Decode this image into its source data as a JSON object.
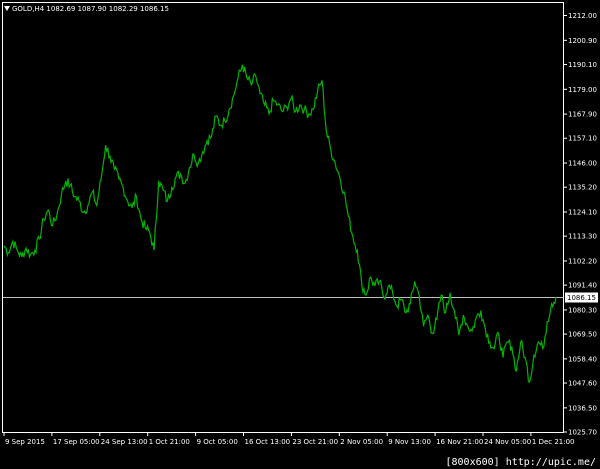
{
  "header": {
    "symbol": "GOLD,H4",
    "open": "1082.69",
    "high": "1087.90",
    "low": "1082.29",
    "close": "1086.15"
  },
  "current_price_label": "1086.15",
  "watermark": "[800x600] http://upic.me/",
  "colors": {
    "background": "#000000",
    "axis": "#ffffff",
    "series": "#00b400",
    "bid_line": "#c0c0c0",
    "text": "#ffffff"
  },
  "chart_data": {
    "type": "line",
    "title": "GOLD,H4",
    "y_ticks": [
      "1212.00",
      "1200.90",
      "1190.10",
      "1179.00",
      "1167.90",
      "1157.10",
      "1146.00",
      "1135.20",
      "1124.10",
      "1113.30",
      "1102.20",
      "1091.40",
      "1080.30",
      "1069.50",
      "1058.40",
      "1047.60",
      "1036.50",
      "1025.70"
    ],
    "x_ticks": [
      "9 Sep 2015",
      "17 Sep 05:00",
      "24 Sep 13:00",
      "1 Oct 21:00",
      "9 Oct 05:00",
      "16 Oct 13:00",
      "23 Oct 21:00",
      "2 Nov 05:00",
      "9 Nov 13:00",
      "16 Nov 21:00",
      "24 Nov 05:00",
      "1 Dec 21:00"
    ],
    "ylim": [
      1025.7,
      1212.0
    ],
    "bid": 1086.15,
    "series": [
      {
        "values": [
          1109,
          1106,
          1111,
          1107,
          1104,
          1108,
          1105,
          1107,
          1112,
          1121,
          1125,
          1118,
          1123,
          1132,
          1138,
          1136,
          1131,
          1129,
          1124,
          1127,
          1133,
          1127,
          1139,
          1154,
          1149,
          1143,
          1139,
          1135,
          1129,
          1126,
          1131,
          1121,
          1117,
          1115,
          1107,
          1138,
          1134,
          1129,
          1135,
          1140,
          1141,
          1137,
          1144,
          1150,
          1146,
          1151,
          1156,
          1158,
          1167,
          1163,
          1165,
          1170,
          1176,
          1184,
          1190,
          1184,
          1181,
          1185,
          1177,
          1172,
          1168,
          1174,
          1172,
          1169,
          1171,
          1175,
          1169,
          1172,
          1170,
          1168,
          1170,
          1178,
          1183,
          1160,
          1152,
          1146,
          1140,
          1133,
          1122,
          1113,
          1107,
          1092,
          1087,
          1095,
          1091,
          1093,
          1086,
          1091,
          1088,
          1082,
          1085,
          1079,
          1083,
          1093,
          1087,
          1073,
          1078,
          1070,
          1076,
          1087,
          1079,
          1088,
          1080,
          1069,
          1078,
          1073,
          1071,
          1077,
          1080,
          1072,
          1066,
          1063,
          1070,
          1059,
          1066,
          1064,
          1053,
          1066,
          1059,
          1048,
          1060,
          1066,
          1063,
          1075,
          1083,
          1086
        ]
      }
    ]
  }
}
